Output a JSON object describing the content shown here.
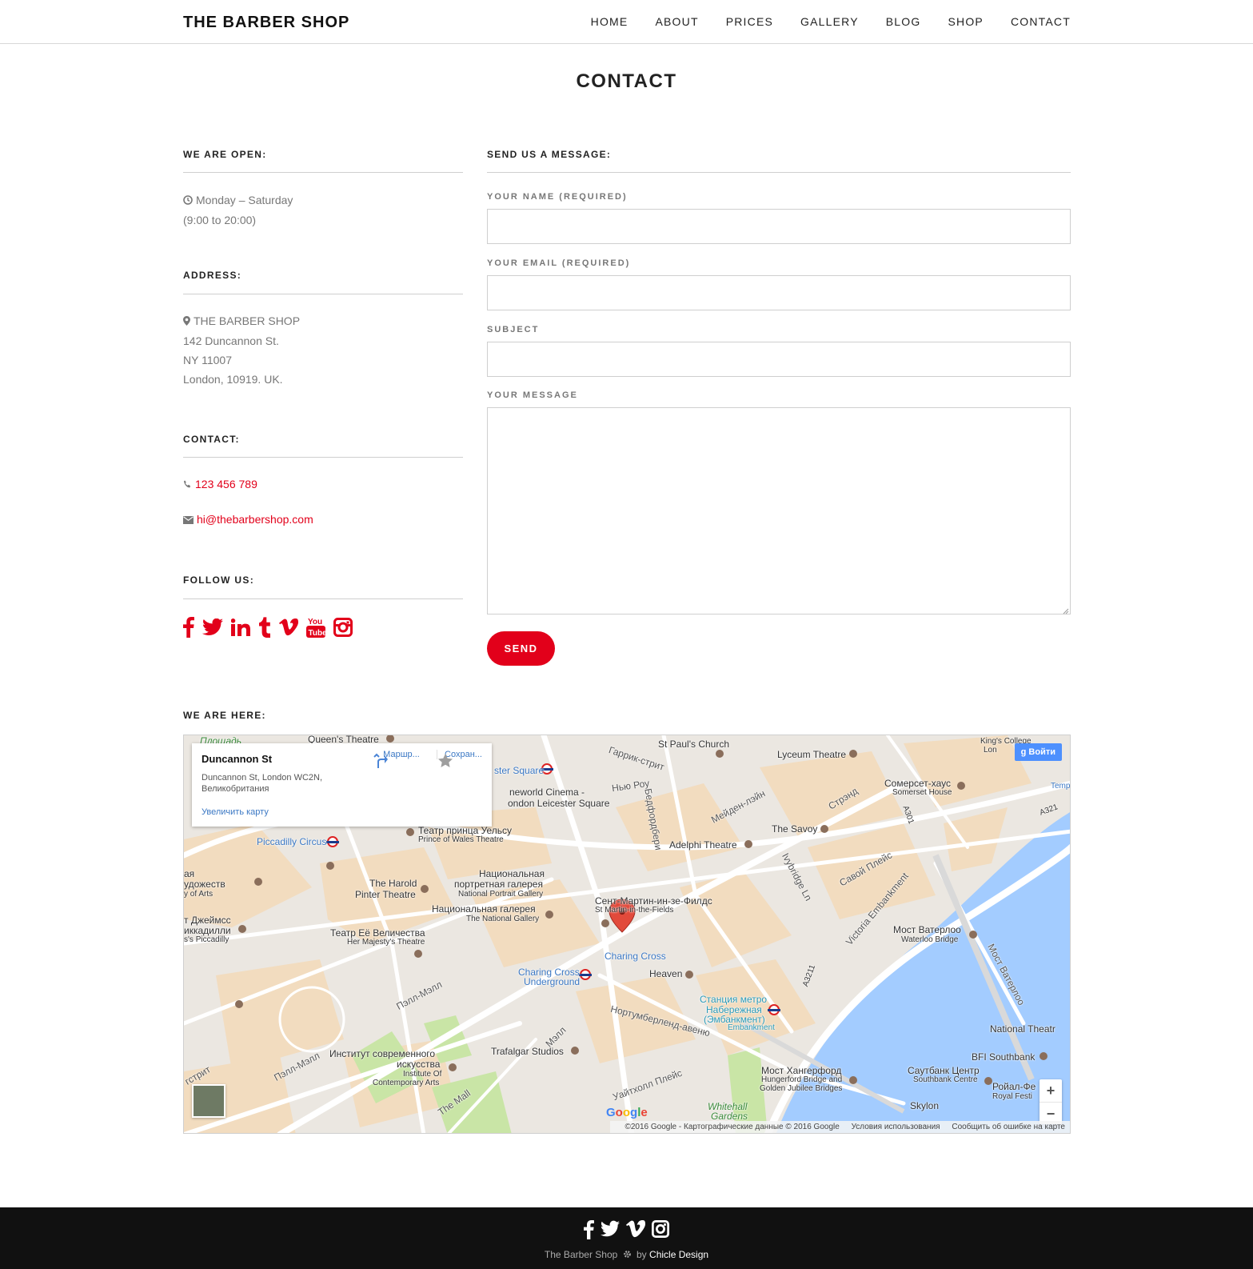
{
  "header": {
    "logo": "THE BARBER SHOP",
    "nav": [
      "HOME",
      "ABOUT",
      "PRICES",
      "GALLERY",
      "BLOG",
      "SHOP",
      "CONTACT"
    ]
  },
  "page_title": "CONTACT",
  "hours": {
    "heading": "WE ARE OPEN:",
    "days": "Monday – Saturday",
    "time": "(9:00 to 20:00)"
  },
  "address": {
    "heading": "ADDRESS:",
    "lines": [
      "THE BARBER SHOP",
      "142 Duncannon St.",
      "NY 11007",
      "London, 10919. UK."
    ]
  },
  "contact": {
    "heading": "CONTACT:",
    "phone": "123 456 789",
    "email": "hi@thebarbershop.com"
  },
  "follow": {
    "heading": "FOLLOW US:",
    "icons": [
      "facebook-icon",
      "twitter-icon",
      "linkedin-icon",
      "tumblr-icon",
      "vimeo-icon",
      "youtube-icon",
      "instagram-icon"
    ]
  },
  "form": {
    "heading": "SEND US A MESSAGE:",
    "name_label": "YOUR NAME (REQUIRED)",
    "email_label": "YOUR EMAIL (REQUIRED)",
    "subject_label": "SUBJECT",
    "message_label": "YOUR MESSAGE",
    "name_value": "",
    "email_value": "",
    "subject_value": "",
    "message_value": "",
    "send_label": "SEND"
  },
  "map": {
    "heading": "WE ARE HERE:",
    "card_title": "Duncannon St",
    "card_address": "Duncannon St, London WC2N, Великобритания",
    "card_enlarge": "Увеличить карту",
    "card_route": "Маршр...",
    "card_save": "Сохран...",
    "signin": "Войти",
    "google": "Google",
    "attribution": "©2016 Google - Картографические данные © 2016 Google",
    "terms": "Условия использования",
    "report": "Сообщить об ошибке на карте",
    "zoom_in": "+",
    "zoom_out": "−",
    "labels": {
      "queens_theatre": "Queen's Theatre",
      "st_pauls": "St Paul's Church",
      "lyceum": "Lyceum Theatre",
      "kings_college": "King's College",
      "kings_college2": "Lon",
      "somerset_ru": "Сомерсет-хаус",
      "somerset_en": "Somerset House",
      "temp": "Temp",
      "leicester_sq": "ster Square",
      "garrick": "Гаррик-стрит",
      "newrow": "Нью Роу",
      "bedford": "Бедфордбери",
      "maiden": "Мейден-лэйн",
      "strand": "Стрэнд",
      "a301": "A301",
      "a3211": "A3211",
      "a321": "A321",
      "cineworld1": "neworld Cinema -",
      "cineworld2": "ondon Leicester Square",
      "piccadilly": "Piccadilly Circus",
      "prince_ru": "Театр принца Уельсу",
      "prince_en": "Prince of Wales Theatre",
      "savoy": "The Savoy",
      "adelphi": "Adelphi Theatre",
      "ivybridge": "Ivybridge Ln",
      "savoy_place": "Савой Плейс",
      "victoria_emb": "Victoria Embankment",
      "harold1": "The Harold",
      "harold2": "Pinter Theatre",
      "npg_ru1": "Национальная",
      "npg_ru2": "портретная галерея",
      "npg_en": "National Portrait Gallery",
      "arts1": "ая",
      "arts2": "удожеств",
      "arts3": "y of Arts",
      "smif_ru": "Сент-Мартин-ин-зе-Филдс",
      "smif_en": "St Martin-in-the-Fields",
      "ng_ru": "Национальная галерея",
      "ng_en": "The National Gallery",
      "jamess1": "т Джеймсс",
      "jamess2": "иккадилли",
      "jamess3": "s's Piccadilly",
      "hm_ru": "Театр Её Величества",
      "hm_en": "Her Majesty's Theatre",
      "charing": "Charing Cross",
      "waterloo_ru": "Мост Ватерлоо",
      "waterloo_en": "Waterloo Bridge",
      "waterloo_road": "Мост Ватерлоо",
      "heaven": "Heaven",
      "cc_under1": "Charing Cross",
      "cc_under2": "Underground",
      "emb_ru1": "Станция метро",
      "emb_ru2": "Набережная",
      "emb_ru3": "(Эмбанкмент)",
      "emb_en": "Embankment",
      "pall_mall": "Пэлл-Мэлл",
      "pall_mall2": "Пэлл-Мэлл",
      "northumberland": "Нортумберленд-авеню",
      "mall": "Мэлл",
      "nat_theatre": "National Theatr",
      "ica_ru1": "Институт современного",
      "ica_ru2": "искусства",
      "ica_en1": "Institute Of",
      "ica_en2": "Contemporary Arts",
      "trafalgar": "Trafalgar Studios",
      "whitehall_pl": "Уайтхолл Плейс",
      "bfi": "BFI Southbank",
      "hungerford_ru": "Мост Хангерфорд",
      "hungerford_en1": "Hungerford Bridge and",
      "hungerford_en2": "Golden Jubilee Bridges",
      "southbank_ru": "Саутбанк Центр",
      "southbank_en": "Southbank Centre",
      "royal_ru": "Ройал-Фе",
      "royal_en": "Royal Festi",
      "skylon": "Skylon",
      "whitehall_g1": "Whitehall",
      "whitehall_g2": "Gardens",
      "the_mall": "The Mall",
      "kstreet": "гстрит",
      "square": "Площадь"
    }
  },
  "footer": {
    "brand": "The Barber Shop",
    "by": "by",
    "designer": "Chicle Design",
    "icons": [
      "facebook-icon",
      "twitter-icon",
      "vimeo-icon",
      "instagram-icon"
    ]
  },
  "colors": {
    "accent": "#e2001a",
    "footer_bg": "#111111",
    "water": "#a3ccff",
    "park": "#c9e5a6",
    "block": "#f1dcc0"
  }
}
